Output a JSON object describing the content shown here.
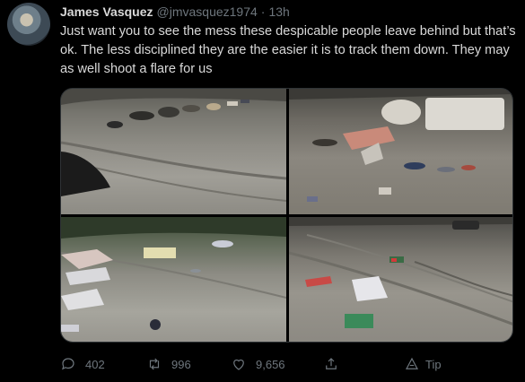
{
  "tweet": {
    "author_name": "James Vasquez",
    "handle": "@jmvasquez1974",
    "separator": "·",
    "time": "13h",
    "text": "Just want you to see the mess these despicable people leave behind but that’s ok. The less disciplined they are the easier it is to track them down. They may as well shoot a flare for us"
  },
  "media": {
    "photo_count": 4
  },
  "actions": {
    "reply_count": "402",
    "retweet_count": "996",
    "like_count": "9,656",
    "tip_label": "Tip"
  },
  "icons": {
    "reply": "reply-icon",
    "retweet": "retweet-icon",
    "like": "heart-icon",
    "share": "share-icon",
    "tip": "tip-icon"
  },
  "colors": {
    "background": "#000000",
    "text": "#d9d9d9",
    "muted": "#6e767d",
    "border": "#2f3336"
  }
}
